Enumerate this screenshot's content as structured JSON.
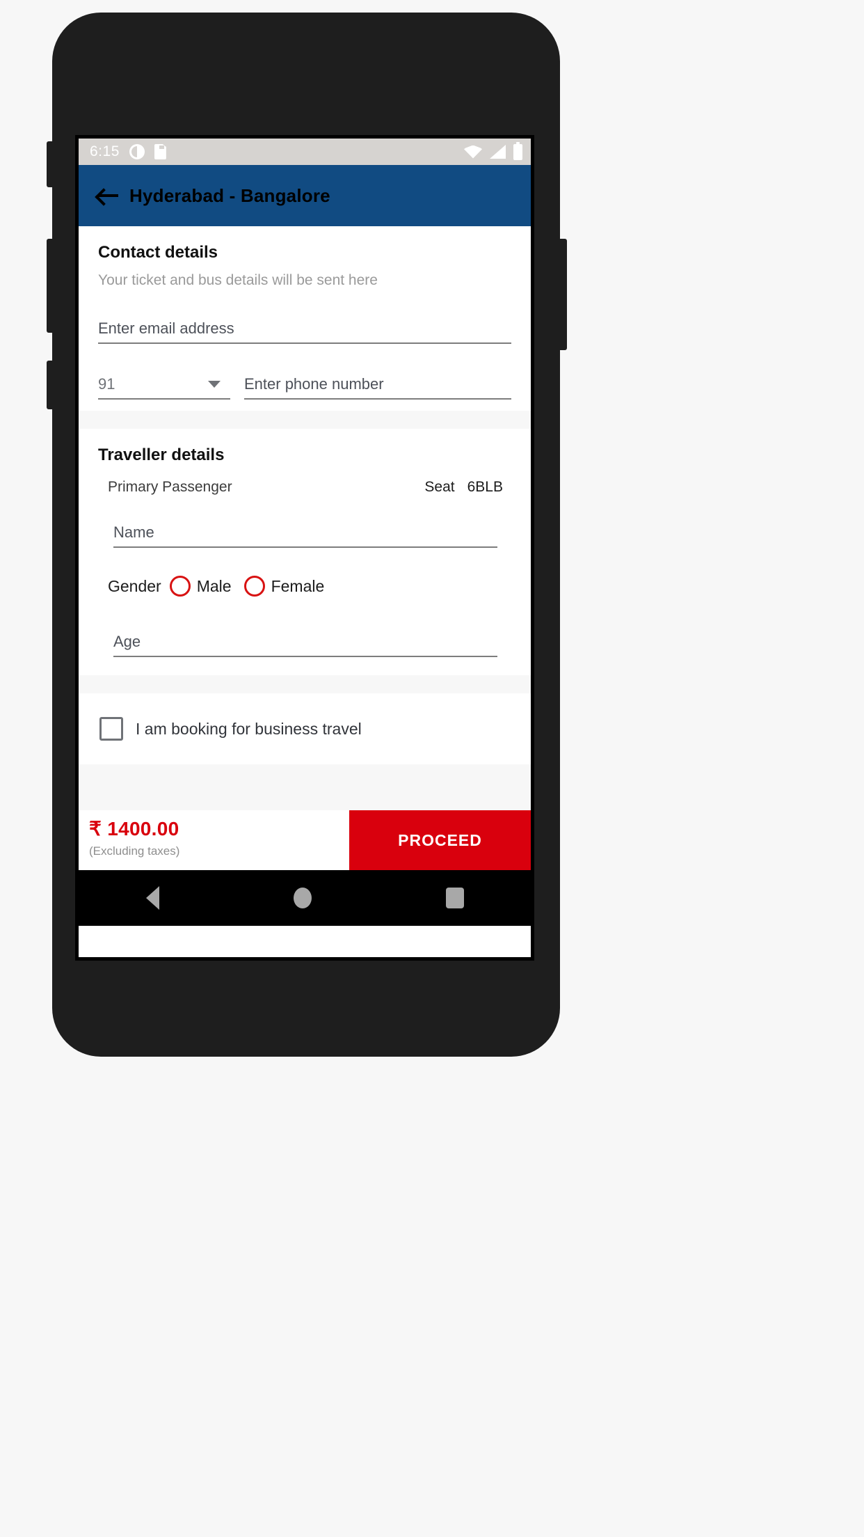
{
  "statusbar": {
    "time": "6:15",
    "left_icons": [
      "mood-icon",
      "sdcard-icon"
    ],
    "right_icons": [
      "wifi-icon",
      "signal-icon",
      "battery-icon"
    ]
  },
  "appbar": {
    "title": "Hyderabad - Bangalore",
    "back_icon": "back-arrow-icon",
    "bg_color": "#114b82"
  },
  "contact": {
    "heading": "Contact details",
    "subtitle": "Your ticket and bus details will be sent here",
    "email_placeholder": "Enter email address",
    "email_value": "",
    "country_code": "91",
    "phone_placeholder": "Enter phone number",
    "phone_value": ""
  },
  "traveller": {
    "heading": "Traveller details",
    "passenger_label": "Primary Passenger",
    "seat_label": "Seat",
    "seat_number": "6BLB",
    "name_placeholder": "Name",
    "name_value": "",
    "gender_label": "Gender",
    "gender_options": [
      "Male",
      "Female"
    ],
    "gender_selected": "",
    "age_placeholder": "Age",
    "age_value": ""
  },
  "business": {
    "checkbox_label": "I am booking for business travel",
    "checked": false
  },
  "bottombar": {
    "price": "₹ 1400.00",
    "taxes_note": "(Excluding taxes)",
    "proceed_label": "PROCEED",
    "accent_color": "#d9000d"
  },
  "navbar": {
    "back": "nav-back-icon",
    "home": "nav-home-icon",
    "recent": "nav-recent-icon"
  }
}
